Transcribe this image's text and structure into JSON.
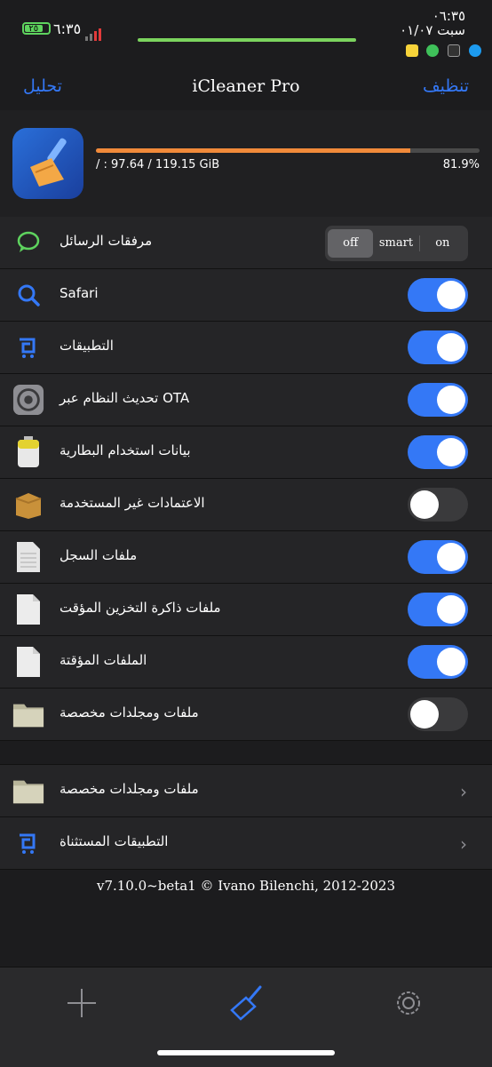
{
  "status": {
    "battery": "٢٥",
    "time_left": "٦:٣٥",
    "time_right": "٠٦:٣٥",
    "date_right": "سبت ٠١/٠٧"
  },
  "nav": {
    "left": "تحليل",
    "title": "iCleaner Pro",
    "right": "تنظيف"
  },
  "storage": {
    "text": "/ : 97.64 / 119.15 GiB",
    "percent_label": "81.9%",
    "used_fraction": 0.819
  },
  "rows": [
    {
      "label": "مرفقات الرسائل",
      "control": "segmented"
    },
    {
      "label": "Safari",
      "state": "on"
    },
    {
      "label": "التطبيقات",
      "state": "on"
    },
    {
      "label": "تحديث النظام عبر OTA",
      "state": "on"
    },
    {
      "label": "بيانات استخدام البطارية",
      "state": "on"
    },
    {
      "label": "الاعتمادات غير المستخدمة",
      "state": "off"
    },
    {
      "label": "ملفات السجل",
      "state": "on"
    },
    {
      "label": "ملفات ذاكرة التخزين المؤقت",
      "state": "on"
    },
    {
      "label": "الملفات المؤقتة",
      "state": "on"
    },
    {
      "label": "ملفات ومجلدات مخصصة",
      "state": "off"
    }
  ],
  "segmented": {
    "off": "off",
    "smart": "smart",
    "on": "on",
    "selected": "off"
  },
  "rows2": [
    {
      "label": "ملفات ومجلدات مخصصة"
    },
    {
      "label": "التطبيقات المستثناة"
    }
  ],
  "version": "v7.10.0~beta1 © Ivano Bilenchi, 2012-2023",
  "colors": {
    "accent": "#3478f6",
    "progress": "#f18a3a",
    "background": "#1c1c1e"
  },
  "tabs": [
    {
      "icon": "plus-icon"
    },
    {
      "icon": "broom-icon"
    },
    {
      "icon": "gear-icon"
    }
  ]
}
